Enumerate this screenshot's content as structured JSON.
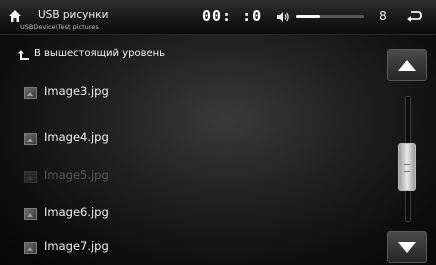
{
  "header": {
    "title": "USB рисунки",
    "path": "USBDevice\\Test pictures",
    "clock": "00: :0",
    "volume_value": "8",
    "volume_level": 0.35
  },
  "list": {
    "up_label": "В вышестоящий уровень",
    "items": [
      {
        "name": "Image3.jpg",
        "state": "normal"
      },
      {
        "name": "Image4.jpg",
        "state": "normal"
      },
      {
        "name": "Image5.jpg",
        "state": "dimmed"
      },
      {
        "name": "Image6.jpg",
        "state": "normal"
      },
      {
        "name": "Image7.jpg",
        "state": "normal"
      }
    ]
  },
  "scrollbar": {
    "position": 0.62
  },
  "icons": {
    "home": "home-icon",
    "speaker": "speaker-icon",
    "back": "back-icon",
    "up": "up-level-icon",
    "file": "image-file-icon",
    "scroll_up": "arrow-up-icon",
    "scroll_down": "arrow-down-icon"
  },
  "colors": {
    "text": "#f0f0f0",
    "dimmed_text": "#5a5a5a",
    "background": "#1e1e1e"
  }
}
